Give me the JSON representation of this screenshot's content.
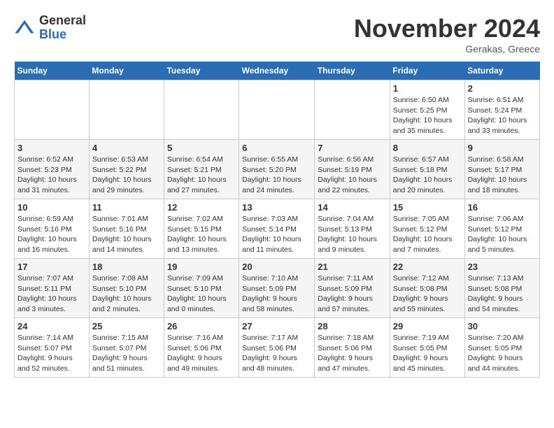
{
  "header": {
    "logo_general": "General",
    "logo_blue": "Blue",
    "month_title": "November 2024",
    "location": "Gerakas, Greece"
  },
  "weekdays": [
    "Sunday",
    "Monday",
    "Tuesday",
    "Wednesday",
    "Thursday",
    "Friday",
    "Saturday"
  ],
  "weeks": [
    [
      {
        "day": "",
        "info": ""
      },
      {
        "day": "",
        "info": ""
      },
      {
        "day": "",
        "info": ""
      },
      {
        "day": "",
        "info": ""
      },
      {
        "day": "",
        "info": ""
      },
      {
        "day": "1",
        "info": "Sunrise: 6:50 AM\nSunset: 5:25 PM\nDaylight: 10 hours and 35 minutes."
      },
      {
        "day": "2",
        "info": "Sunrise: 6:51 AM\nSunset: 5:24 PM\nDaylight: 10 hours and 33 minutes."
      }
    ],
    [
      {
        "day": "3",
        "info": "Sunrise: 6:52 AM\nSunset: 5:23 PM\nDaylight: 10 hours and 31 minutes."
      },
      {
        "day": "4",
        "info": "Sunrise: 6:53 AM\nSunset: 5:22 PM\nDaylight: 10 hours and 29 minutes."
      },
      {
        "day": "5",
        "info": "Sunrise: 6:54 AM\nSunset: 5:21 PM\nDaylight: 10 hours and 27 minutes."
      },
      {
        "day": "6",
        "info": "Sunrise: 6:55 AM\nSunset: 5:20 PM\nDaylight: 10 hours and 24 minutes."
      },
      {
        "day": "7",
        "info": "Sunrise: 6:56 AM\nSunset: 5:19 PM\nDaylight: 10 hours and 22 minutes."
      },
      {
        "day": "8",
        "info": "Sunrise: 6:57 AM\nSunset: 5:18 PM\nDaylight: 10 hours and 20 minutes."
      },
      {
        "day": "9",
        "info": "Sunrise: 6:58 AM\nSunset: 5:17 PM\nDaylight: 10 hours and 18 minutes."
      }
    ],
    [
      {
        "day": "10",
        "info": "Sunrise: 6:59 AM\nSunset: 5:16 PM\nDaylight: 10 hours and 16 minutes."
      },
      {
        "day": "11",
        "info": "Sunrise: 7:01 AM\nSunset: 5:16 PM\nDaylight: 10 hours and 14 minutes."
      },
      {
        "day": "12",
        "info": "Sunrise: 7:02 AM\nSunset: 5:15 PM\nDaylight: 10 hours and 13 minutes."
      },
      {
        "day": "13",
        "info": "Sunrise: 7:03 AM\nSunset: 5:14 PM\nDaylight: 10 hours and 11 minutes."
      },
      {
        "day": "14",
        "info": "Sunrise: 7:04 AM\nSunset: 5:13 PM\nDaylight: 10 hours and 9 minutes."
      },
      {
        "day": "15",
        "info": "Sunrise: 7:05 AM\nSunset: 5:12 PM\nDaylight: 10 hours and 7 minutes."
      },
      {
        "day": "16",
        "info": "Sunrise: 7:06 AM\nSunset: 5:12 PM\nDaylight: 10 hours and 5 minutes."
      }
    ],
    [
      {
        "day": "17",
        "info": "Sunrise: 7:07 AM\nSunset: 5:11 PM\nDaylight: 10 hours and 3 minutes."
      },
      {
        "day": "18",
        "info": "Sunrise: 7:08 AM\nSunset: 5:10 PM\nDaylight: 10 hours and 2 minutes."
      },
      {
        "day": "19",
        "info": "Sunrise: 7:09 AM\nSunset: 5:10 PM\nDaylight: 10 hours and 0 minutes."
      },
      {
        "day": "20",
        "info": "Sunrise: 7:10 AM\nSunset: 5:09 PM\nDaylight: 9 hours and 58 minutes."
      },
      {
        "day": "21",
        "info": "Sunrise: 7:11 AM\nSunset: 5:09 PM\nDaylight: 9 hours and 57 minutes."
      },
      {
        "day": "22",
        "info": "Sunrise: 7:12 AM\nSunset: 5:08 PM\nDaylight: 9 hours and 55 minutes."
      },
      {
        "day": "23",
        "info": "Sunrise: 7:13 AM\nSunset: 5:08 PM\nDaylight: 9 hours and 54 minutes."
      }
    ],
    [
      {
        "day": "24",
        "info": "Sunrise: 7:14 AM\nSunset: 5:07 PM\nDaylight: 9 hours and 52 minutes."
      },
      {
        "day": "25",
        "info": "Sunrise: 7:15 AM\nSunset: 5:07 PM\nDaylight: 9 hours and 51 minutes."
      },
      {
        "day": "26",
        "info": "Sunrise: 7:16 AM\nSunset: 5:06 PM\nDaylight: 9 hours and 49 minutes."
      },
      {
        "day": "27",
        "info": "Sunrise: 7:17 AM\nSunset: 5:06 PM\nDaylight: 9 hours and 48 minutes."
      },
      {
        "day": "28",
        "info": "Sunrise: 7:18 AM\nSunset: 5:06 PM\nDaylight: 9 hours and 47 minutes."
      },
      {
        "day": "29",
        "info": "Sunrise: 7:19 AM\nSunset: 5:05 PM\nDaylight: 9 hours and 45 minutes."
      },
      {
        "day": "30",
        "info": "Sunrise: 7:20 AM\nSunset: 5:05 PM\nDaylight: 9 hours and 44 minutes."
      }
    ]
  ]
}
